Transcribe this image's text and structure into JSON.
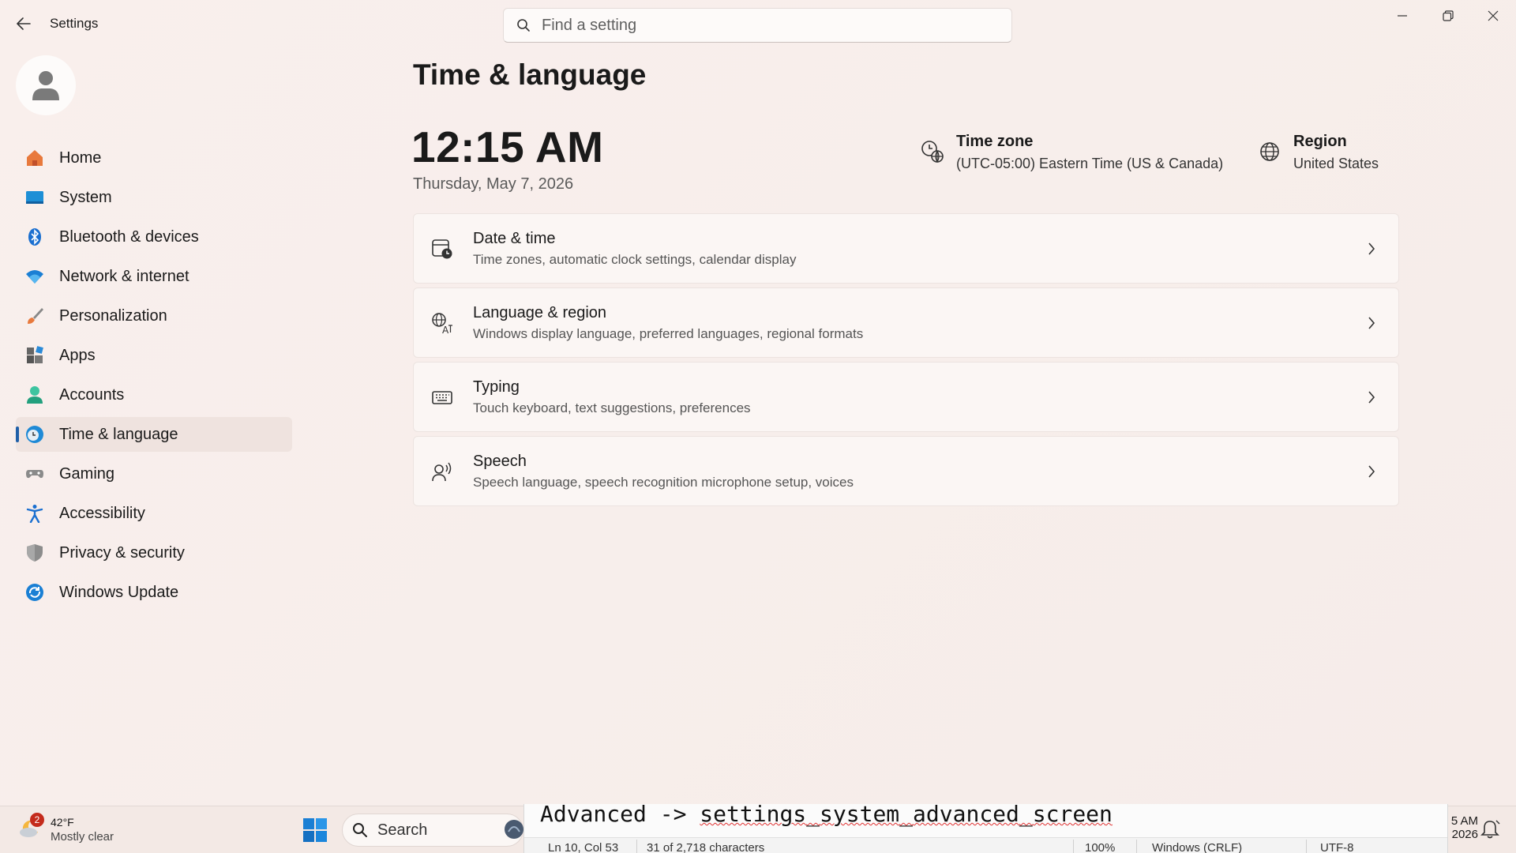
{
  "window": {
    "title": "Settings"
  },
  "search": {
    "placeholder": "Find a setting"
  },
  "sidebar": {
    "items": [
      {
        "label": "Home",
        "icon": "home-icon"
      },
      {
        "label": "System",
        "icon": "system-icon"
      },
      {
        "label": "Bluetooth & devices",
        "icon": "bluetooth-icon"
      },
      {
        "label": "Network & internet",
        "icon": "wifi-icon"
      },
      {
        "label": "Personalization",
        "icon": "brush-icon"
      },
      {
        "label": "Apps",
        "icon": "apps-icon"
      },
      {
        "label": "Accounts",
        "icon": "accounts-icon"
      },
      {
        "label": "Time & language",
        "icon": "time-language-icon",
        "active": true
      },
      {
        "label": "Gaming",
        "icon": "gamepad-icon"
      },
      {
        "label": "Accessibility",
        "icon": "accessibility-icon"
      },
      {
        "label": "Privacy & security",
        "icon": "shield-icon"
      },
      {
        "label": "Windows Update",
        "icon": "update-icon"
      }
    ]
  },
  "main": {
    "title": "Time & language",
    "time": "12:15 AM",
    "date": "Thursday, May 7, 2026",
    "timezone": {
      "title": "Time zone",
      "value": "(UTC-05:00) Eastern Time (US & Canada)"
    },
    "region": {
      "title": "Region",
      "value": "United States"
    },
    "cards": [
      {
        "title": "Date & time",
        "desc": "Time zones, automatic clock settings, calendar display",
        "icon": "calendar-clock-icon"
      },
      {
        "title": "Language & region",
        "desc": "Windows display language, preferred languages, regional formats",
        "icon": "language-icon"
      },
      {
        "title": "Typing",
        "desc": "Touch keyboard, text suggestions, preferences",
        "icon": "keyboard-icon"
      },
      {
        "title": "Speech",
        "desc": "Speech language, speech recognition microphone setup, voices",
        "icon": "speech-icon"
      }
    ]
  },
  "taskbar": {
    "weather": {
      "temp": "42°F",
      "condition": "Mostly clear",
      "badge": "2"
    },
    "search_label": "Search",
    "clock_time": "5 AM",
    "clock_date": "2026"
  },
  "notepad": {
    "line_prefix": "Advanced -> ",
    "line_words": [
      "settings",
      "_",
      "system",
      "_",
      "advanced",
      "_",
      "screen"
    ],
    "status": {
      "position": "Ln 10, Col 53",
      "chars": "31 of 2,718 characters",
      "zoom": "100%",
      "line_ending": "Windows (CRLF)",
      "encoding": "UTF-8"
    }
  },
  "colors": {
    "accent": "#1f5fa8",
    "background": "#f8eeea"
  }
}
